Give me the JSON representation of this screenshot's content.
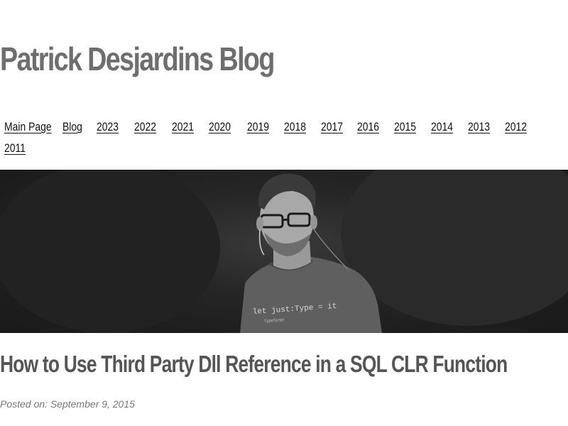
{
  "site": {
    "title": "Patrick Desjardins Blog"
  },
  "nav": {
    "items": [
      {
        "label": "Main Page"
      },
      {
        "label": "Blog"
      },
      {
        "label": "2023"
      },
      {
        "label": "2022"
      },
      {
        "label": "2021"
      },
      {
        "label": "2020"
      },
      {
        "label": "2019"
      },
      {
        "label": "2018"
      },
      {
        "label": "2017"
      },
      {
        "label": "2016"
      },
      {
        "label": "2015"
      },
      {
        "label": "2014"
      },
      {
        "label": "2013"
      },
      {
        "label": "2012"
      },
      {
        "label": "2011"
      }
    ]
  },
  "hero": {
    "shirt_text": "let just:Type = it",
    "shirt_subtext": "TypeScript"
  },
  "post": {
    "title": "How to Use Third Party Dll Reference in a SQL CLR Function",
    "posted_on": "Posted on: September 9, 2015"
  },
  "colors": {
    "title": "#6e6e6e",
    "nav_link": "#111111",
    "hero_bg": "#1e1e1e",
    "post_title": "#555555",
    "post_date": "#777777"
  }
}
